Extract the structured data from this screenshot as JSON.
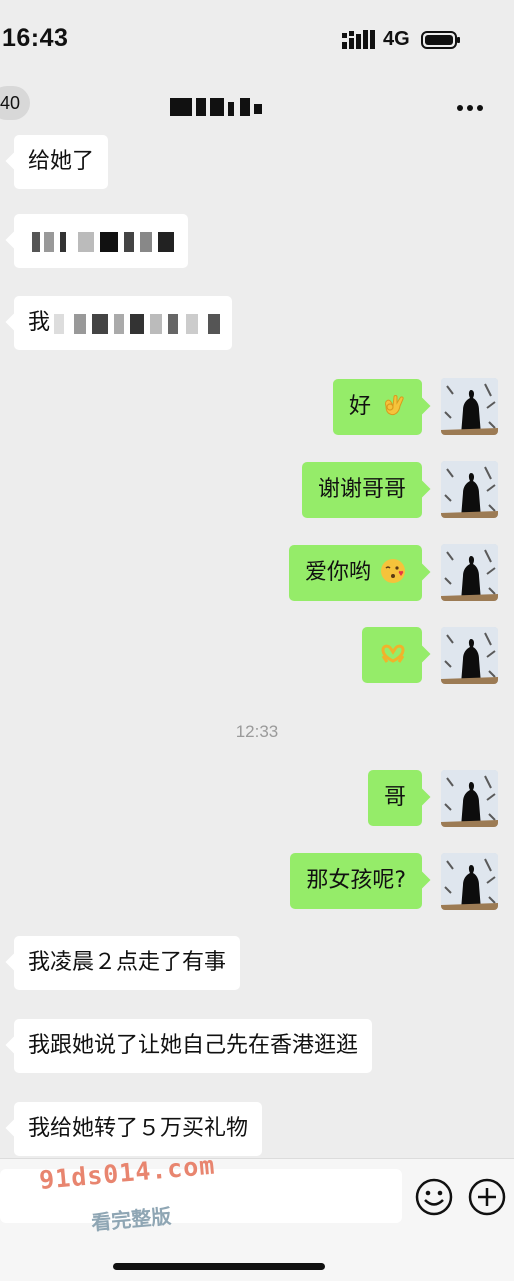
{
  "status_bar": {
    "time": "16:43",
    "network": "4G"
  },
  "nav": {
    "back_count": "40"
  },
  "messages": [
    {
      "side": "left",
      "text": "给她了"
    },
    {
      "side": "left",
      "text": ""
    },
    {
      "side": "left",
      "text": "我"
    },
    {
      "side": "right",
      "text": "好",
      "emoji": "ok-hand-emoji"
    },
    {
      "side": "right",
      "text": "谢谢哥哥"
    },
    {
      "side": "right",
      "text": "爱你哟",
      "emoji": "kissing-face-emoji"
    },
    {
      "side": "right",
      "text": "",
      "emoji": "heart-hands-emoji"
    },
    {
      "side": "right",
      "text": "哥"
    },
    {
      "side": "right",
      "text": "那女孩呢?"
    },
    {
      "side": "left",
      "text": "我凌晨２点走了有事"
    },
    {
      "side": "left",
      "text": "我跟她说了让她自己先在香港逛逛"
    },
    {
      "side": "left",
      "text": "我给她转了５万买礼物"
    }
  ],
  "timestamp": "12:33",
  "watermark": {
    "domain": "91ds014.com",
    "caption": "看完整版"
  },
  "colors": {
    "background": "#ededed",
    "bubble_self": "#95ec69",
    "bubble_other": "#ffffff"
  }
}
